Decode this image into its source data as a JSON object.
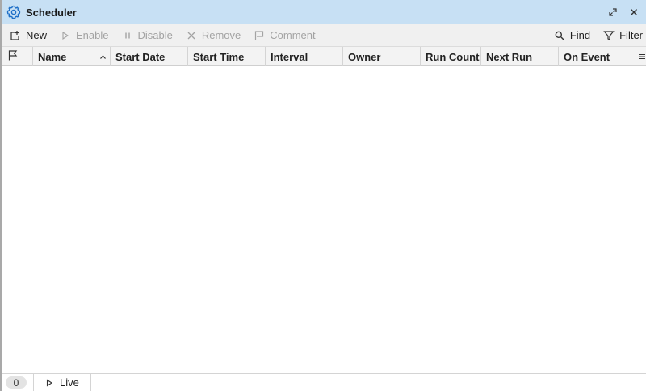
{
  "window": {
    "title": "Scheduler",
    "icon": "gear-icon"
  },
  "toolbar": {
    "new_label": "New",
    "enable_label": "Enable",
    "disable_label": "Disable",
    "remove_label": "Remove",
    "comment_label": "Comment",
    "find_label": "Find",
    "filter_label": "Filter"
  },
  "table": {
    "columns": [
      {
        "label": "Name",
        "sorted": "ascending"
      },
      {
        "label": "Start Date"
      },
      {
        "label": "Start Time"
      },
      {
        "label": "Interval"
      },
      {
        "label": "Owner"
      },
      {
        "label": "Run Count"
      },
      {
        "label": "Next Run"
      },
      {
        "label": "On Event"
      }
    ],
    "rows": []
  },
  "status": {
    "count": "0",
    "live_label": "Live"
  },
  "colors": {
    "titlebar": "#c7e0f4",
    "accent_icon": "#1e6fc7",
    "disabled_text": "#a3a3a3"
  }
}
